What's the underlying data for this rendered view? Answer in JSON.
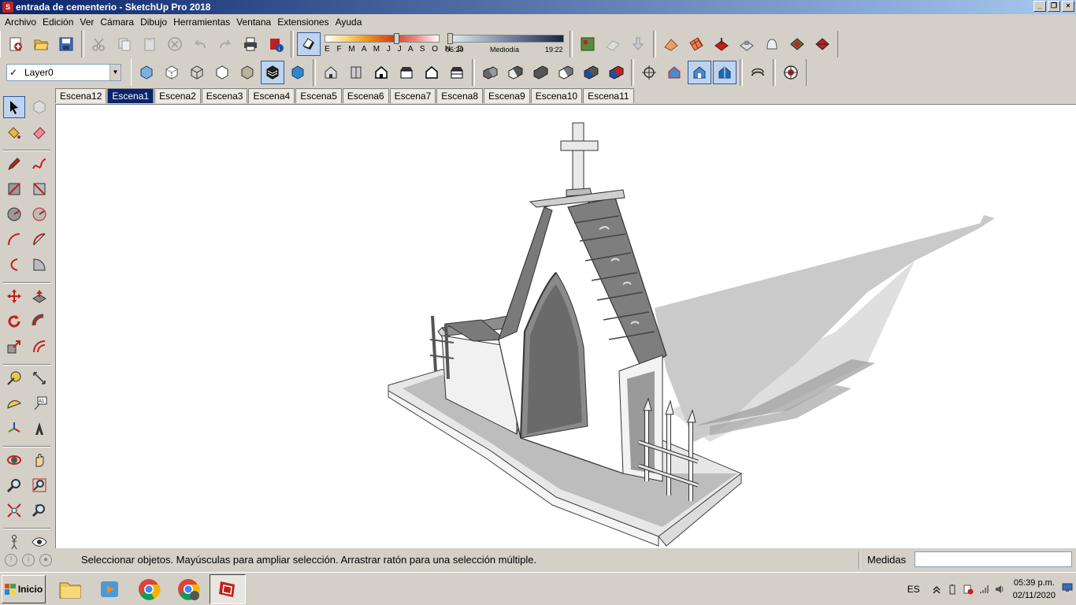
{
  "window": {
    "title": "entrada de cementerio - SketchUp Pro 2018"
  },
  "menu": [
    "Archivo",
    "Edición",
    "Ver",
    "Cámara",
    "Dibujo",
    "Herramientas",
    "Ventana",
    "Extensiones",
    "Ayuda"
  ],
  "shadow": {
    "months": "E F M A M J J A S O N D",
    "time_start": "06:20",
    "time_mid": "Mediodía",
    "time_end": "19:22"
  },
  "layer": {
    "current": "Layer0"
  },
  "scenes": [
    "Escena12",
    "Escena1",
    "Escena2",
    "Escena3",
    "Escena4",
    "Escena5",
    "Escena6",
    "Escena7",
    "Escena8",
    "Escena9",
    "Escena10",
    "Escena11"
  ],
  "active_scene": "Escena1",
  "status": {
    "message": "Seleccionar objetos. Mayúsculas para ampliar selección. Arrastrar ratón para una selección múltiple.",
    "measure_label": "Medidas",
    "measure_value": ""
  },
  "taskbar": {
    "start_label": "Inicio",
    "language": "ES",
    "time": "05:39 p.m.",
    "date": "02/11/2020"
  },
  "colors": {
    "accent": "#0a246a",
    "sketchup_red": "#c0211f",
    "chrome": "#d4d0c8"
  }
}
